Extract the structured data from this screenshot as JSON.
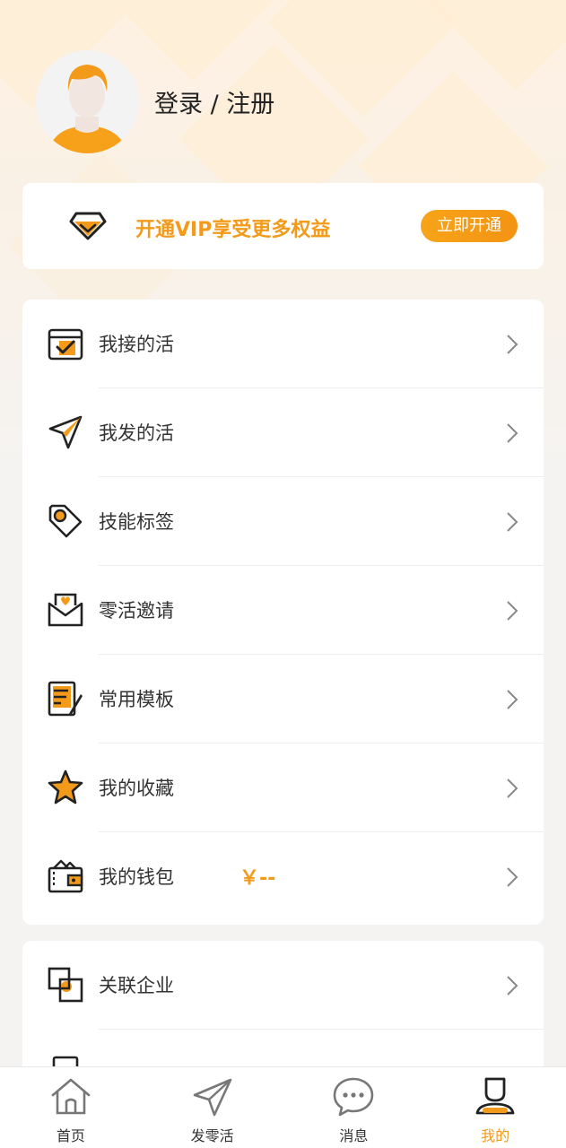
{
  "profile": {
    "login_label": "登录 / 注册"
  },
  "vip": {
    "text": "开通VIP享受更多权益",
    "button_label": "立即开通",
    "icon": "diamond-icon"
  },
  "menu_main": [
    {
      "label": "我接的活",
      "icon": "task-box-icon"
    },
    {
      "label": "我发的活",
      "icon": "paper-plane-icon"
    },
    {
      "label": "技能标签",
      "icon": "tag-icon"
    },
    {
      "label": "零活邀请",
      "icon": "invitation-envelope-icon"
    },
    {
      "label": "常用模板",
      "icon": "template-document-icon"
    },
    {
      "label": "我的收藏",
      "icon": "star-icon"
    },
    {
      "label": "我的钱包",
      "icon": "wallet-icon",
      "amount": "￥--"
    }
  ],
  "menu_secondary": [
    {
      "label": "关联企业",
      "icon": "linked-company-icon"
    }
  ],
  "tabbar": [
    {
      "label": "首页",
      "icon": "home-icon",
      "active": false
    },
    {
      "label": "发零活",
      "icon": "send-icon",
      "active": false
    },
    {
      "label": "消息",
      "icon": "chat-bubble-icon",
      "active": false
    },
    {
      "label": "我的",
      "icon": "user-icon",
      "active": true
    }
  ],
  "colors": {
    "accent": "#f39a1a",
    "text": "#333333",
    "icon_stroke": "#222222"
  }
}
